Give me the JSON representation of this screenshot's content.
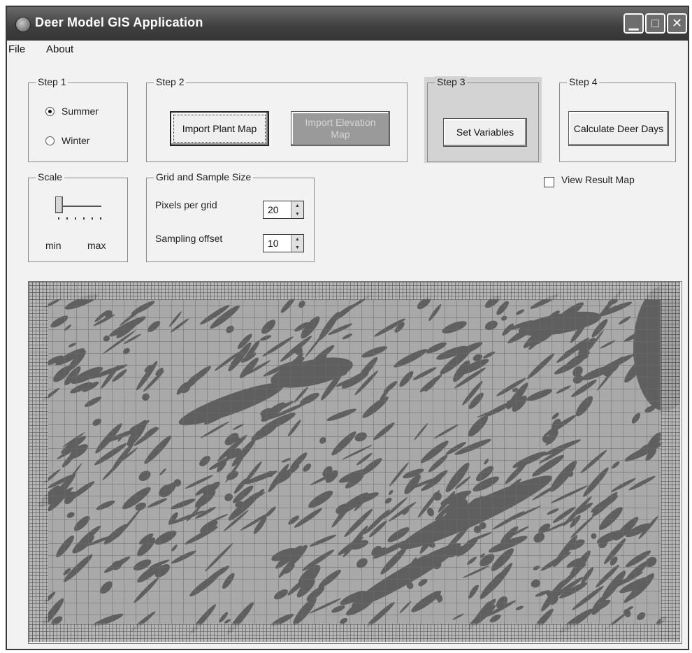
{
  "window": {
    "title": "Deer Model GIS Application"
  },
  "title_buttons": {
    "minimize": "▁",
    "maximize": "□",
    "close": "✕"
  },
  "menu": {
    "file": "File",
    "about": "About"
  },
  "step1": {
    "label": "Step 1",
    "options": [
      "Summer",
      "Winter"
    ],
    "selected": "Summer"
  },
  "step2": {
    "label": "Step 2",
    "import_plant": "Import Plant Map",
    "import_elevation": "Import Elevation Map"
  },
  "step3": {
    "label": "Step 3",
    "set_variables": "Set Variables"
  },
  "step4": {
    "label": "Step 4",
    "calculate": "Calculate Deer Days"
  },
  "view_result": {
    "label": "View Result Map",
    "checked": false
  },
  "scale": {
    "label": "Scale",
    "min": "min",
    "max": "max",
    "value": 0
  },
  "grid": {
    "label": "Grid and Sample Size",
    "pixels_label": "Pixels per grid",
    "pixels_value": "20",
    "offset_label": "Sampling offset",
    "offset_value": "10"
  },
  "map": {
    "background": "#a9a9a9",
    "feature_color": "#5f5f5f",
    "grid_color": "#6c6c6c"
  }
}
